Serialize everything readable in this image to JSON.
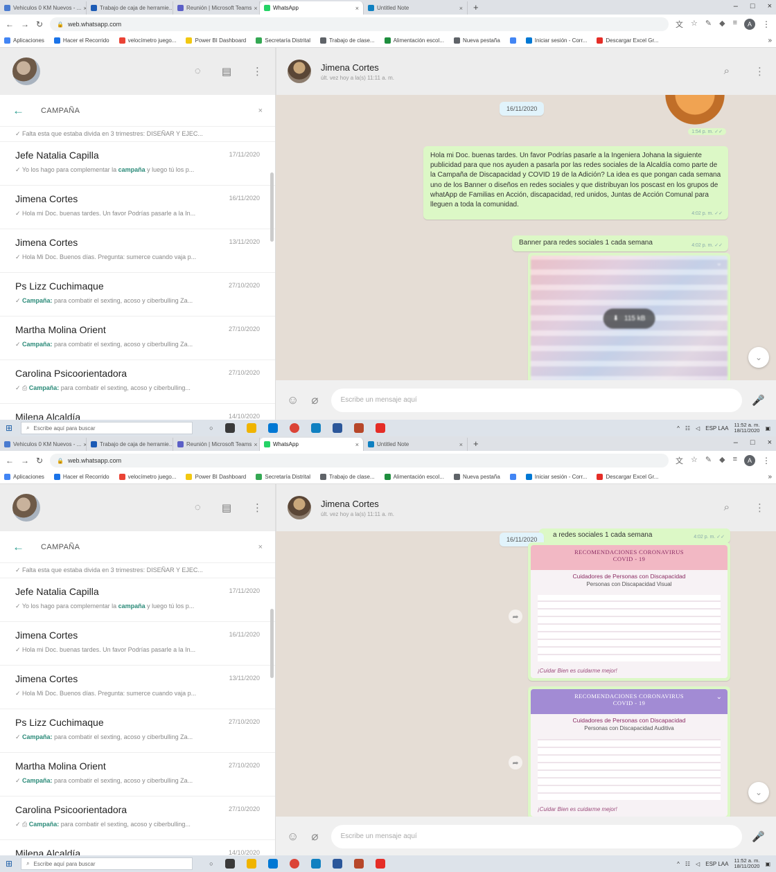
{
  "browser": {
    "tabs": [
      {
        "label": "Vehiculos 0 KM Nuevos - ...",
        "color": "#4a7bd0"
      },
      {
        "label": "Trabajo de caja de herramie...",
        "color": "#1b5ab5"
      },
      {
        "label": "Reunión | Microsoft Teams",
        "color": "#5b5fc7"
      },
      {
        "label": "WhatsApp",
        "color": "#25d366",
        "active": true
      },
      {
        "label": "Untitled Note",
        "color": "#0f80c1"
      }
    ],
    "new_tab": "+",
    "url": "web.whatsapp.com",
    "window_controls": [
      "–",
      "□",
      "×"
    ],
    "profile_initial": "A",
    "bookmarks": [
      {
        "label": "Aplicaciones",
        "color": "#4285f4"
      },
      {
        "label": "Hacer el Recorrido",
        "color": "#1a73e8"
      },
      {
        "label": "velocímetro juego...",
        "color": "#ea4335"
      },
      {
        "label": "Power BI Dashboard",
        "color": "#f2c811"
      },
      {
        "label": "Secretaría Distrital",
        "color": "#34a853"
      },
      {
        "label": "Trabajo de clase...",
        "color": "#5f6368"
      },
      {
        "label": "Alimentación escol...",
        "color": "#1e8e3e"
      },
      {
        "label": "Nueva pestaña",
        "color": "#5f6368"
      },
      {
        "label": "",
        "color": "#4285f4"
      },
      {
        "label": "Iniciar sesión - Corr...",
        "color": "#0078d4"
      },
      {
        "label": "Descargar Excel Gr...",
        "color": "#e52d27"
      }
    ],
    "bookmarks_more": "»"
  },
  "sidebar": {
    "icons": {
      "status": "status-icon",
      "new_chat": "new-chat-icon",
      "menu": "menu-icon"
    },
    "search": {
      "back": "←",
      "query": "CAMPAÑA",
      "clear": "×"
    },
    "truncated_result": "✓ Falta esta que estaba divida en 3 trimestres: DISEÑAR Y EJEC...",
    "chats": [
      {
        "name": "Jefe Natalia Capilla",
        "date": "17/11/2020",
        "pre": "✓ Yo los hago para complementar la ",
        "kw": "campaña",
        "post": " y luego tú los p..."
      },
      {
        "name": "Jimena Cortes",
        "date": "16/11/2020",
        "pre": "✓ Hola mi Doc. buenas tardes. Un favor Podrías pasarle a la In...",
        "kw": "",
        "post": ""
      },
      {
        "name": "Jimena Cortes",
        "date": "13/11/2020",
        "pre": "✓ Hola Mi Doc. Buenos días. Pregunta: sumerce cuando vaja p...",
        "kw": "",
        "post": ""
      },
      {
        "name": "Ps Lizz Cuchimaque",
        "date": "27/10/2020",
        "pre": "✓ ",
        "kw": "Campaña:",
        "post": " para combatir el sexting, acoso y ciberbulling Za..."
      },
      {
        "name": "Martha Molina Orient",
        "date": "27/10/2020",
        "pre": "✓ ",
        "kw": "Campaña:",
        "post": " para combatir el sexting, acoso y ciberbulling Za..."
      },
      {
        "name": "Carolina Psicoorientadora",
        "date": "27/10/2020",
        "pre": "✓ ⎙ ",
        "kw": "Campaña:",
        "post": " para combatir el sexting, acoso y ciberbulling..."
      },
      {
        "name": "Milena Alcaldía",
        "date": "14/10/2020",
        "pre": "",
        "kw": "",
        "post": ""
      }
    ]
  },
  "conversation": {
    "name": "Jimena Cortes",
    "status": "últ. vez hoy a la(s) 11:11 a. m.",
    "date_pill": "16/11/2020",
    "sticker_time": "1:54 p. m. ✓✓",
    "message_text": "Hola mi Doc. buenas tardes. Un favor Podrías pasarle a la Ingeniera Johana la siguiente publicidad para que nos ayuden a pasarla por las redes sociales de la Alcaldía como parte de la Campaña de Discapacidad y COVID 19 de la Adición? La idea es que pongan cada semana uno de los Banner o diseños en redes sociales y que distribuyan los poscast en los grupos de whatApp de Familias en Acción, discapacidad, red unidos, Juntas de Acción Comunal para lleguen a toda la comunidad.",
    "message_time": "4:02 p. m. ✓✓",
    "banner_caption": "Banner para redes sociales 1 cada semana",
    "banner_caption_partial": "a redes sociales 1 cada semana",
    "banner_time": "4:02 p. m. ✓✓",
    "download_label": "115 kB",
    "poster1": {
      "title_line1": "RECOMENDACIONES CORONAVIRUS",
      "title_line2": "COVID - 19",
      "subtitle": "Cuidadores de Personas con Discapacidad",
      "type": "Personas con Discapacidad Visual",
      "footer": "¡Cuidar Bien es cuidarme mejor!",
      "color": "#f2b8c4"
    },
    "poster2": {
      "title_line1": "RECOMENDACIONES CORONAVIRUS",
      "title_line2": "COVID - 19",
      "subtitle": "Cuidadores de Personas con Discapacidad",
      "type": "Personas con Discapacidad Auditiva",
      "footer": "¡Cuidar Bien es cuidarme mejor!",
      "color": "#a28bd4"
    },
    "composer_placeholder": "Escribe un mensaje aquí",
    "icons": {
      "emoji": "☺",
      "attach": "⌀",
      "mic": "🎤"
    }
  },
  "taskbar": {
    "search_placeholder": "Escribe aquí para buscar",
    "apps": [
      "#3a3a3a",
      "#f0b400",
      "#0078d4",
      "#db4437",
      "#0f80c1",
      "#2b579a",
      "#b7472a",
      "#e52d27"
    ],
    "tray_lang": "ESP LAA",
    "time": "11:52 a. m.",
    "date": "18/11/2020"
  }
}
